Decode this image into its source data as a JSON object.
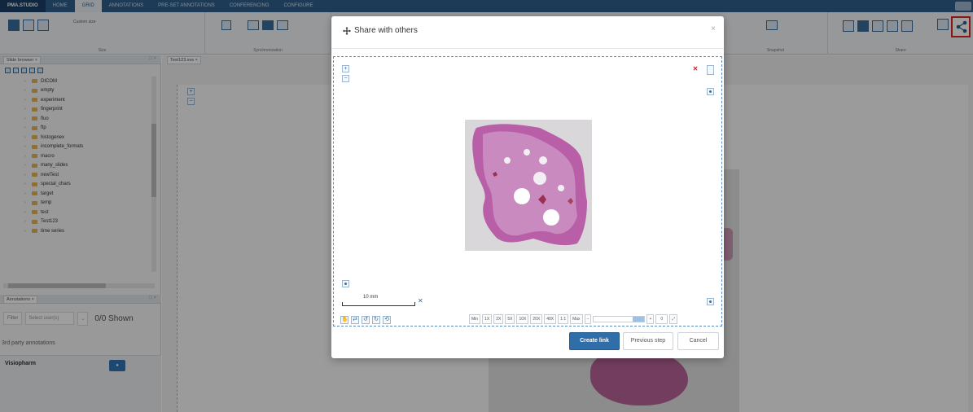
{
  "app": {
    "tabs": [
      {
        "label": "PMA.STUDIO"
      },
      {
        "label": "HOME"
      },
      {
        "label": "GRID"
      },
      {
        "label": "ANNOTATIONS"
      },
      {
        "label": "PRE-SET ANNOTATIONS"
      },
      {
        "label": "CONFERENCING"
      },
      {
        "label": "CONFIGURE"
      }
    ],
    "active_tab_index": 2
  },
  "ribbon": {
    "custom_size_label": "Custom size",
    "groups": {
      "size": "Size",
      "synchronization": "Synchronization",
      "snapshot": "Snapshot",
      "share": "Share"
    },
    "highlight_color": "#e02424"
  },
  "slide_browser": {
    "tab_label": "Slide browser",
    "folders": [
      "DICOM",
      "empty",
      "experiment",
      "fingerprint",
      "fluo",
      "ftp",
      "histogenex",
      "incomplete_formats",
      "macro",
      "many_slides",
      "newTest",
      "special_chars",
      "target",
      "temp",
      "test",
      "Test123",
      "time series"
    ]
  },
  "annotations": {
    "tab_label": "Annotations",
    "filter_label": "Filter",
    "select_placeholder": "Select user(s)",
    "shown_count": "0/0 Shown",
    "third_party_label": "3rd party annotations",
    "visiopharm_label": "Visiopharm"
  },
  "viewer": {
    "tab_label": "Test123.svs"
  },
  "modal": {
    "title": "Share with others",
    "close_symbol": "×",
    "scalebar_label": "10 mm",
    "magnifications": [
      "Min",
      "1X",
      "2X",
      "5X",
      "10X",
      "20X",
      "40X",
      "1:1",
      "Max"
    ],
    "zoom_value": "0",
    "buttons": {
      "create": "Create link",
      "previous": "Previous step",
      "cancel": "Cancel"
    }
  }
}
